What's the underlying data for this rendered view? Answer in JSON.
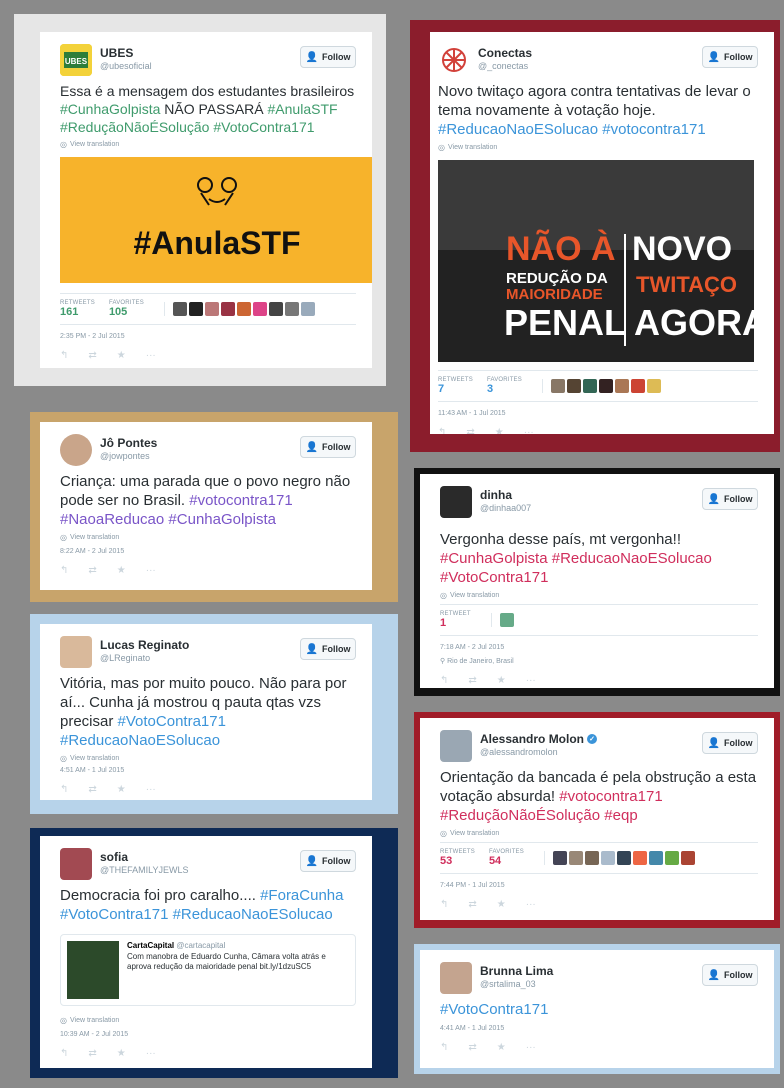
{
  "follow_label": "Follow",
  "view_translation": "View translation",
  "retweets_label": "RETWEETS",
  "retweet_label": "RETWEET",
  "favorites_label": "FAVORITES",
  "colors": {
    "green": "#3f9b6c",
    "blue": "#3b94d9",
    "purple": "#7a55c8",
    "red": "#d02e5c"
  },
  "t1": {
    "name": "UBES",
    "handle": "@ubesoficial",
    "text": "Essa é a mensagem dos estudantes brasileiros",
    "h1": "#CunhaGolpista",
    "mid": "NÃO PASSARÁ",
    "h2": "#AnulaSTF",
    "h3": "#ReduçãoNãoÉSolução",
    "h4": "#VotoContra171",
    "image_text": "#AnulaSTF",
    "retweets": "161",
    "favorites": "105",
    "time": "2:35 PM - 2 Jul 2015"
  },
  "t2": {
    "name": "Conectas",
    "handle": "@_conectas",
    "text": "Novo twitaço agora contra tentativas de levar o tema novamente à votação hoje.",
    "h1": "#ReducaoNaoESolucao",
    "h2": "#votocontra171",
    "img": {
      "nao": "NÃO À",
      "reducao": "REDUÇÃO DA",
      "maioridade": "MAIORIDADE",
      "penal": "PENAL",
      "novo": "NOVO",
      "twitaco": "TWITAÇO",
      "agora": "AGORA"
    },
    "retweets": "7",
    "favorites": "3",
    "time": "11:43 AM - 1 Jul 2015"
  },
  "t3": {
    "name": "Jô Pontes",
    "handle": "@jowpontes",
    "text": "Criança: uma parada que o povo negro não pode ser no Brasil.",
    "h1": "#votocontra171",
    "h2": "#NaoaReducao",
    "h3": "#CunhaGolpista",
    "time": "8:22 AM - 2 Jul 2015"
  },
  "t4": {
    "name": "dinha",
    "handle": "@dinhaa007",
    "text": "Vergonha desse país, mt vergonha!!",
    "h1": "#CunhaGolpista",
    "h2": "#ReducaoNaoESolucao",
    "h3": "#VotoContra171",
    "retweets": "1",
    "time": "7:18 AM - 2 Jul 2015",
    "location": "Rio de Janeiro, Brasil"
  },
  "t5": {
    "name": "Lucas Reginato",
    "handle": "@LReginato",
    "text": "Vitória, mas por muito pouco. Não para por aí... Cunha já mostrou q pauta qtas vzs precisar",
    "h1": "#VotoContra171",
    "h2": "#ReducaoNaoESolucao",
    "time": "4:51 AM - 1 Jul 2015"
  },
  "t6": {
    "name": "Alessandro Molon",
    "handle": "@alessandromolon",
    "text": "Orientação da bancada é pela obstrução a esta votação absurda!",
    "h1": "#votocontra171",
    "h2": "#ReduçãoNãoÉSolução",
    "h3": "#eqp",
    "retweets": "53",
    "favorites": "54",
    "time": "7:44 PM - 1 Jul 2015"
  },
  "t7": {
    "name": "sofia",
    "handle": "@THEFAMILYJEWLS",
    "text": "Democracia foi pro caralho....",
    "h1": "#ForaCunha",
    "h2": "#VotoContra171",
    "h3": "#ReducaoNaoESolucao",
    "card_name": "CartaCapital",
    "card_handle": "@cartacapital",
    "card_text": "Com manobra de Eduardo Cunha, Câmara volta atrás e aprova redução da maioridade penal bit.ly/1dzuSC5",
    "time": "10:39 AM - 2 Jul 2015"
  },
  "t8": {
    "name": "Brunna Lima",
    "handle": "@srtalima_03",
    "h1": "#VotoContra171",
    "time": "4:41 AM - 1 Jul 2015"
  }
}
